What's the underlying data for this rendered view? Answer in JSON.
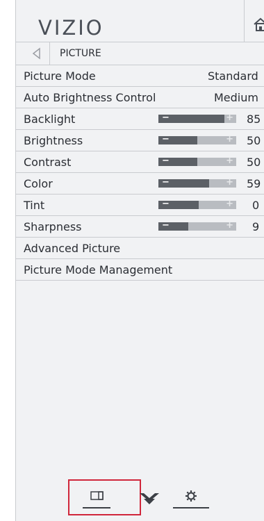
{
  "header": {
    "logo": "VIZIO"
  },
  "breadcrumb": {
    "title": "PICTURE"
  },
  "menu": {
    "rows": [
      {
        "label": "Picture Mode",
        "value": "Standard"
      },
      {
        "label": "Auto Brightness Control",
        "value": "Medium"
      },
      {
        "label": "Backlight",
        "value": "85",
        "level": 0.85
      },
      {
        "label": "Brightness",
        "value": "50",
        "level": 0.5
      },
      {
        "label": "Contrast",
        "value": "50",
        "level": 0.5
      },
      {
        "label": "Color",
        "value": "59",
        "level": 0.65
      },
      {
        "label": "Tint",
        "value": "0",
        "level": 0.52
      },
      {
        "label": "Sharpness",
        "value": "9",
        "level": 0.38
      },
      {
        "label": "Advanced Picture"
      },
      {
        "label": "Picture Mode Management"
      }
    ]
  },
  "slider": {
    "minus": "−",
    "plus": "+"
  },
  "footer": {
    "selected_tab": "picture"
  },
  "colors": {
    "highlight": "#d0263a",
    "panel": "#f1f2f4",
    "slider_fill": "#5c6066",
    "slider_track": "#b9bcc1"
  }
}
